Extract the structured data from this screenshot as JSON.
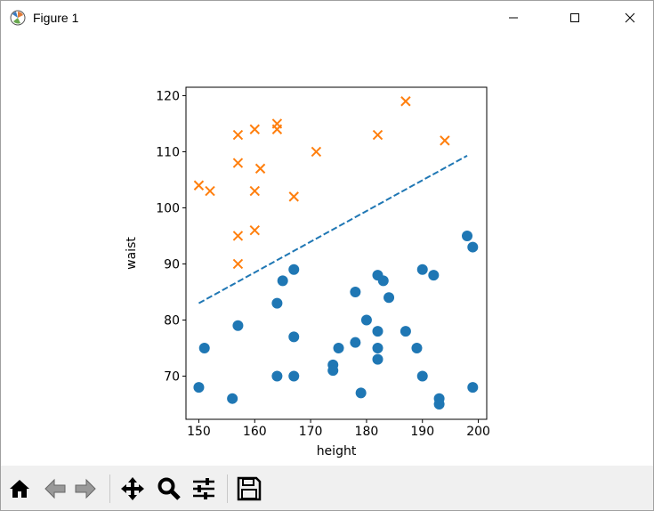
{
  "window": {
    "title": "Figure 1",
    "icons": [
      "matplotlib-icon",
      "minimize-icon",
      "maximize-icon",
      "close-icon"
    ]
  },
  "toolbar": {
    "buttons": [
      "home",
      "back",
      "forward",
      "pan",
      "zoom",
      "configure-subplots",
      "save"
    ]
  },
  "chart_data": {
    "type": "scatter",
    "xlabel": "height",
    "ylabel": "waist",
    "xlim": [
      147.7,
      201.5
    ],
    "ylim": [
      62.3,
      121.5
    ],
    "xticks": [
      150,
      160,
      170,
      180,
      190,
      200
    ],
    "yticks": [
      70,
      80,
      90,
      100,
      110,
      120
    ],
    "grid": false,
    "series": [
      {
        "marker": "o",
        "color": "#1f77b4",
        "points": [
          [
            150,
            68
          ],
          [
            151,
            75
          ],
          [
            156,
            66
          ],
          [
            157,
            79
          ],
          [
            164,
            83
          ],
          [
            164,
            70
          ],
          [
            165,
            87
          ],
          [
            167,
            89
          ],
          [
            167,
            77
          ],
          [
            167,
            70
          ],
          [
            174,
            72
          ],
          [
            174,
            71
          ],
          [
            175,
            75
          ],
          [
            178,
            85
          ],
          [
            178,
            76
          ],
          [
            179,
            67
          ],
          [
            180,
            80
          ],
          [
            182,
            88
          ],
          [
            182,
            78
          ],
          [
            182,
            75
          ],
          [
            182,
            73
          ],
          [
            183,
            87
          ],
          [
            184,
            84
          ],
          [
            187,
            78
          ],
          [
            189,
            75
          ],
          [
            190,
            89
          ],
          [
            190,
            70
          ],
          [
            192,
            88
          ],
          [
            193,
            66
          ],
          [
            193,
            65
          ],
          [
            198,
            95
          ],
          [
            199,
            93
          ],
          [
            199,
            68
          ]
        ]
      },
      {
        "marker": "x",
        "color": "#ff7f0e",
        "points": [
          [
            150,
            104
          ],
          [
            152,
            103
          ],
          [
            157,
            113
          ],
          [
            157,
            108
          ],
          [
            157,
            95
          ],
          [
            157,
            90
          ],
          [
            160,
            114
          ],
          [
            160,
            103
          ],
          [
            160,
            96
          ],
          [
            161,
            107
          ],
          [
            164,
            115
          ],
          [
            164,
            114
          ],
          [
            167,
            102
          ],
          [
            171,
            110
          ],
          [
            182,
            113
          ],
          [
            187,
            119
          ],
          [
            194,
            112
          ]
        ]
      },
      {
        "marker": "dashed-line",
        "color": "#1f77b4",
        "points": [
          [
            150,
            83
          ],
          [
            198,
            109.3
          ]
        ]
      }
    ]
  }
}
